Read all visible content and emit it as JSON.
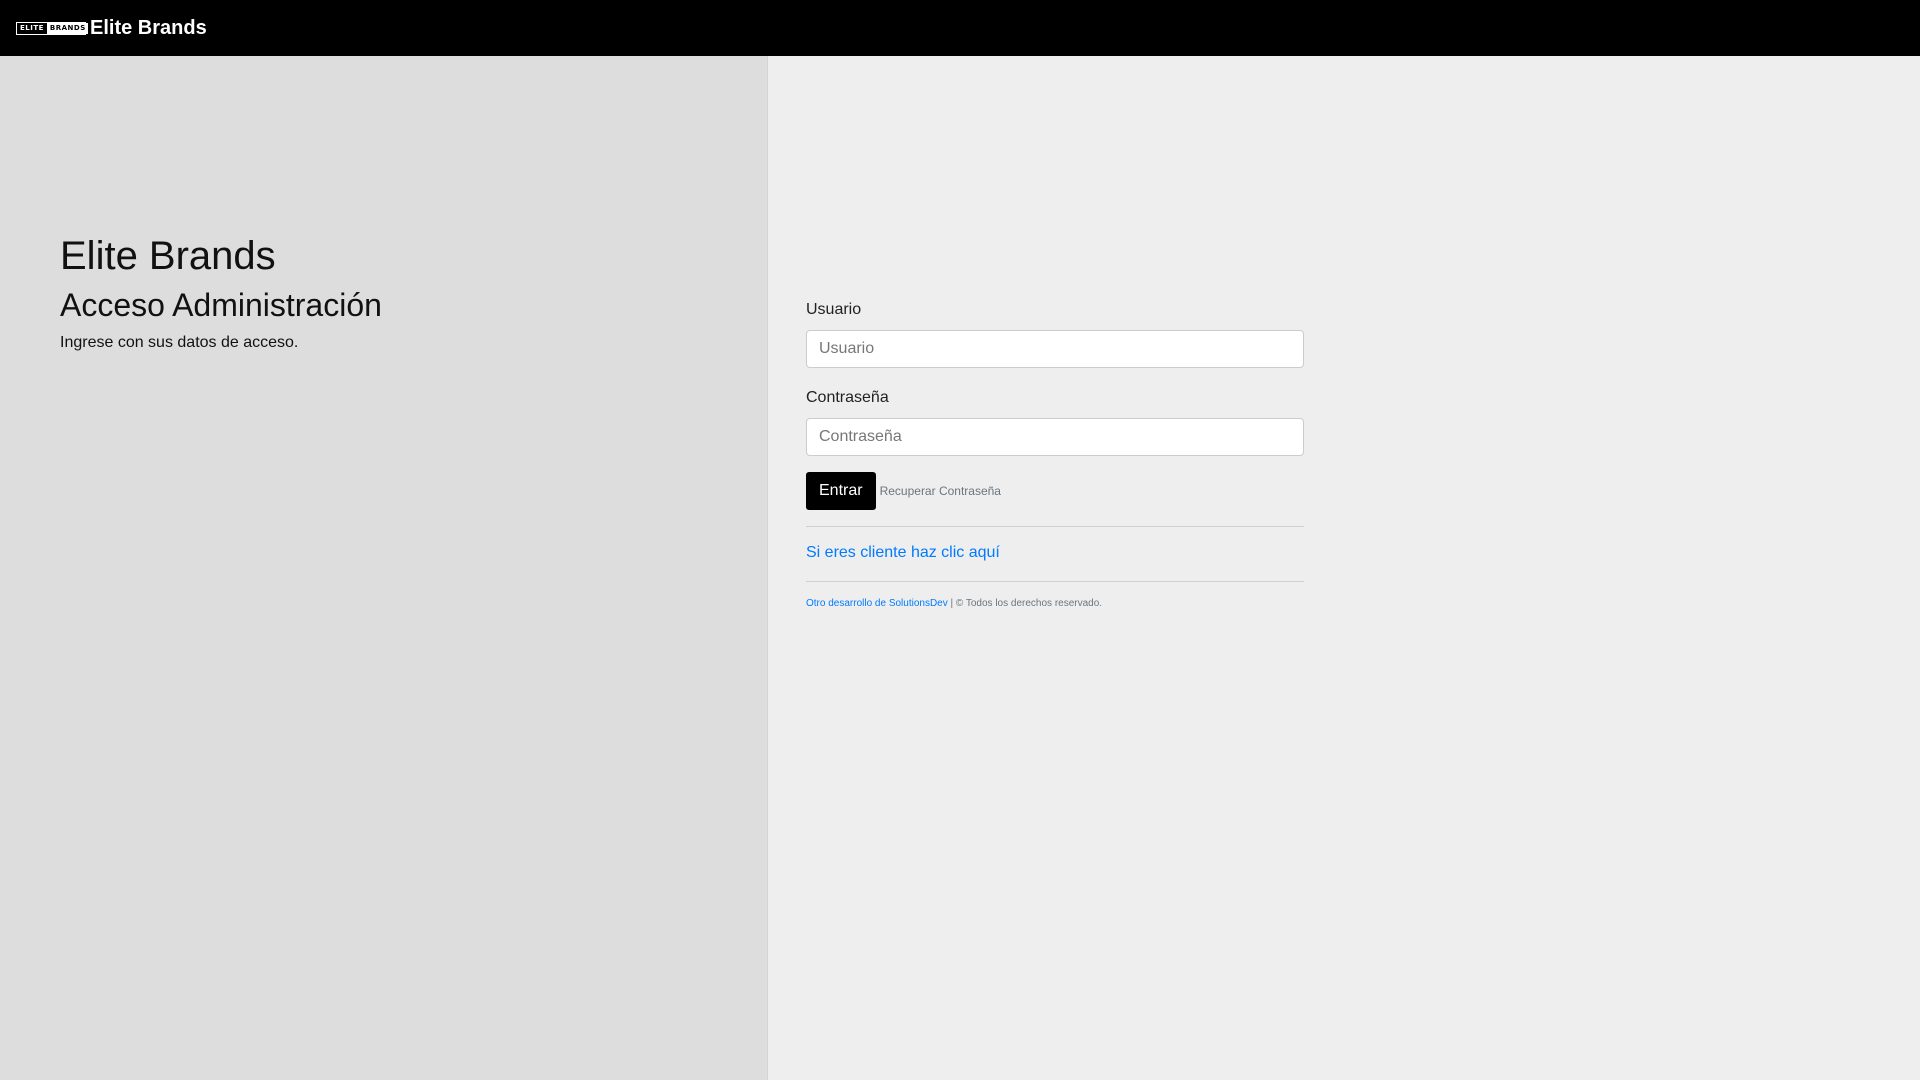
{
  "navbar": {
    "logo": {
      "left_text": "ELITE",
      "right_text": "BRANDS"
    },
    "brand_name": "Elite Brands"
  },
  "hero": {
    "title": "Elite Brands",
    "subtitle": "Acceso Administración",
    "text": "Ingrese con sus datos de acceso."
  },
  "form": {
    "username": {
      "label": "Usuario",
      "placeholder": "Usuario",
      "value": ""
    },
    "password": {
      "label": "Contraseña",
      "placeholder": "Contraseña",
      "value": ""
    },
    "submit_label": "Entrar",
    "recover_label": "Recuperar Contraseña",
    "client_link": "Si eres cliente haz clic aquí"
  },
  "footer": {
    "dev_link": "Otro desarrollo de SolutionsDev",
    "separator": " | ",
    "copyright": "© Todos los derechos reservado."
  },
  "colors": {
    "navbar_bg": "#000000",
    "left_panel_bg": "#dddddd",
    "right_panel_bg": "#eeeeee",
    "primary_button": "#000000",
    "link": "#007bff",
    "muted": "#6c757d"
  }
}
